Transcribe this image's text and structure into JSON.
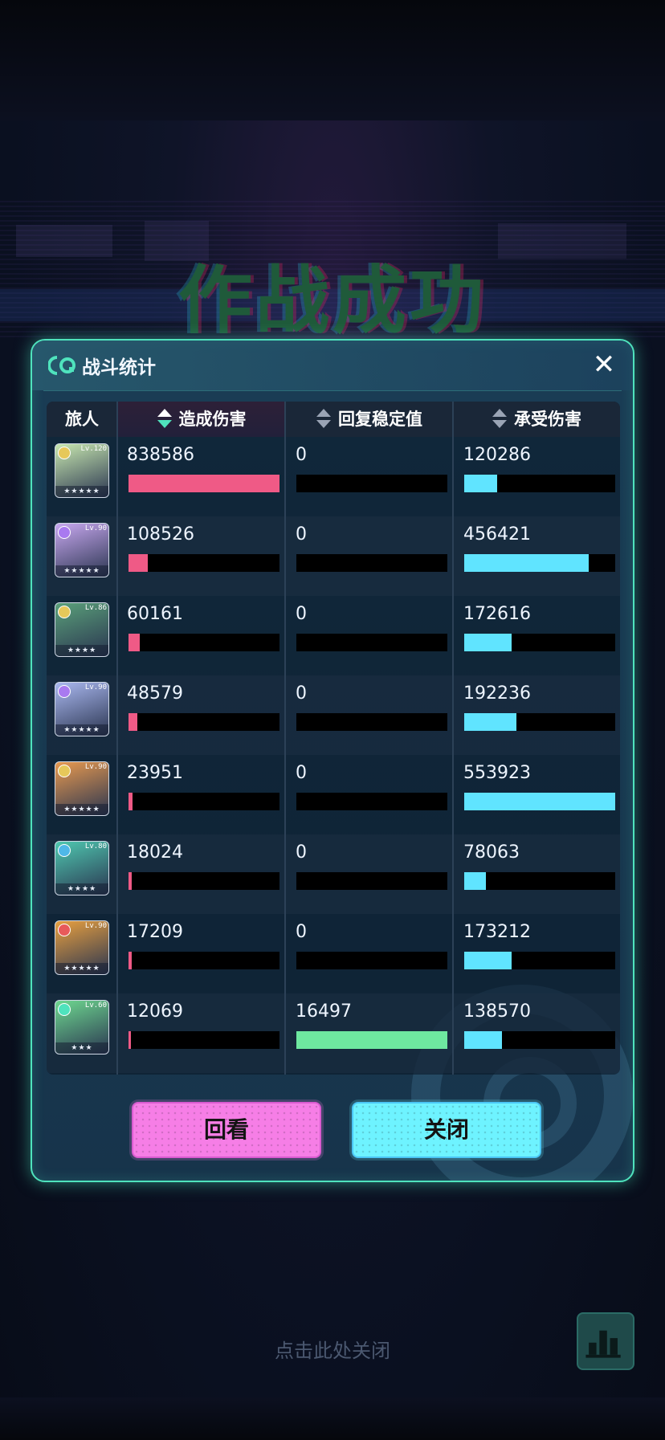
{
  "background": {
    "banner_title": "作战成功"
  },
  "dialog": {
    "title": "战斗统计",
    "close_symbol": "✕",
    "columns": {
      "traveler": "旅人",
      "damage": "造成伤害",
      "stability": "回复稳定值",
      "taken": "承受伤害"
    },
    "rows": [
      {
        "level": "Lv.120",
        "stars": "★★★★★",
        "damage": "838586",
        "stability": "0",
        "taken": "120286",
        "damage_ratio": 1.0,
        "stability_ratio": 0.0,
        "taken_ratio": 0.217,
        "avatar_color": "#c8e8b0",
        "elem_color": "#e6c85a"
      },
      {
        "level": "Lv.90",
        "stars": "★★★★★",
        "damage": "108526",
        "stability": "0",
        "taken": "456421",
        "damage_ratio": 0.129,
        "stability_ratio": 0.0,
        "taken_ratio": 0.824,
        "avatar_color": "#c8a8f0",
        "elem_color": "#a97af0"
      },
      {
        "level": "Lv.86",
        "stars": "★★★★",
        "damage": "60161",
        "stability": "0",
        "taken": "172616",
        "damage_ratio": 0.072,
        "stability_ratio": 0.0,
        "taken_ratio": 0.312,
        "avatar_color": "#5aa07a",
        "elem_color": "#e6c85a"
      },
      {
        "level": "Lv.90",
        "stars": "★★★★★",
        "damage": "48579",
        "stability": "0",
        "taken": "192236",
        "damage_ratio": 0.058,
        "stability_ratio": 0.0,
        "taken_ratio": 0.347,
        "avatar_color": "#aab8f0",
        "elem_color": "#a97af0"
      },
      {
        "level": "Lv.90",
        "stars": "★★★★★",
        "damage": "23951",
        "stability": "0",
        "taken": "553923",
        "damage_ratio": 0.029,
        "stability_ratio": 0.0,
        "taken_ratio": 1.0,
        "avatar_color": "#e89a50",
        "elem_color": "#e6c85a"
      },
      {
        "level": "Lv.80",
        "stars": "★★★★",
        "damage": "18024",
        "stability": "0",
        "taken": "78063",
        "damage_ratio": 0.021,
        "stability_ratio": 0.0,
        "taken_ratio": 0.141,
        "avatar_color": "#4fc8b0",
        "elem_color": "#4fb8e8"
      },
      {
        "level": "Lv.90",
        "stars": "★★★★★",
        "damage": "17209",
        "stability": "0",
        "taken": "173212",
        "damage_ratio": 0.021,
        "stability_ratio": 0.0,
        "taken_ratio": 0.313,
        "avatar_color": "#e8a040",
        "elem_color": "#e85a5a"
      },
      {
        "level": "Lv.60",
        "stars": "★★★",
        "damage": "12069",
        "stability": "16497",
        "taken": "138570",
        "damage_ratio": 0.014,
        "stability_ratio": 1.0,
        "taken_ratio": 0.25,
        "avatar_color": "#6ed890",
        "elem_color": "#4fe3bd"
      }
    ],
    "buttons": {
      "replay": "回看",
      "close": "关闭"
    }
  },
  "footer": {
    "hint": "点击此处关闭",
    "stats_icon": "bar-chart-icon"
  }
}
